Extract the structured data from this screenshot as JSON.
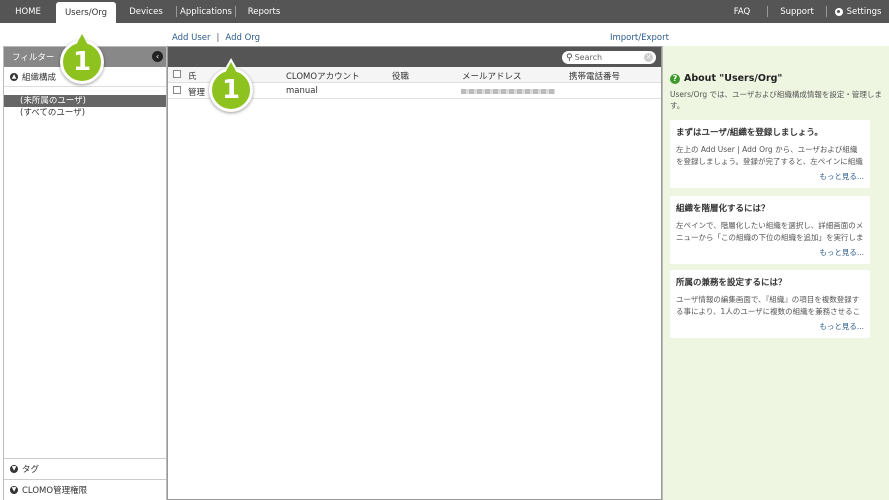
{
  "nav": {
    "items": [
      {
        "label": "HOME"
      },
      {
        "label": "Users/Org"
      },
      {
        "label": "Devices"
      },
      {
        "label": "Applications"
      },
      {
        "label": "Reports"
      }
    ],
    "right": {
      "faq": "FAQ",
      "support": "Support",
      "settings": "Settings"
    }
  },
  "actions": {
    "add_user": "Add User",
    "separator": "|",
    "add_org": "Add Org",
    "import_export": "Import/Export"
  },
  "filter": {
    "title": "フィルター",
    "section_org": "組織構成",
    "tree": [
      "(未所属のユーザ)",
      "(すべてのユーザ)"
    ],
    "section_tag": "タグ",
    "section_admin": "CLOMO管理権限"
  },
  "search": {
    "placeholder": "Search"
  },
  "table": {
    "headers": [
      "氏",
      "CLOMOアカウント",
      "役職",
      "メールアドレス",
      "携帯電話番号"
    ],
    "rows": [
      {
        "name": "管理",
        "account": "manual"
      }
    ]
  },
  "about": {
    "title": "About \"Users/Org\"",
    "description": "Users/Org では、ユーザおよび組織構成情報を設定・管理します。",
    "cards": [
      {
        "title": "まずはユーザ/組織を登録しましょう。",
        "body": "左上の Add User | Add Org から、ユーザおよび組織を登録しましょう。登録が完了すると、左ペインに組織名",
        "more": "もっと見る..."
      },
      {
        "title": "組織を階層化するには？",
        "body": "左ペインで、階層化したい組織を選択し、詳細画面のメニューから「この組織の下位の組織を追加」を実行しま",
        "more": "もっと見る..."
      },
      {
        "title": "所属の兼務を設定するには？",
        "body": "ユーザ情報の編集画面で、『組織』の項目を複数登録する事により、1人のユーザに複数の組織を兼務させるこ",
        "more": "もっと見る..."
      }
    ]
  },
  "callouts": [
    "1",
    "1"
  ],
  "colors": {
    "accent": "#8dc21f",
    "nav": "#555555",
    "link": "#2a5a8a",
    "panel": "#eef5e0"
  }
}
